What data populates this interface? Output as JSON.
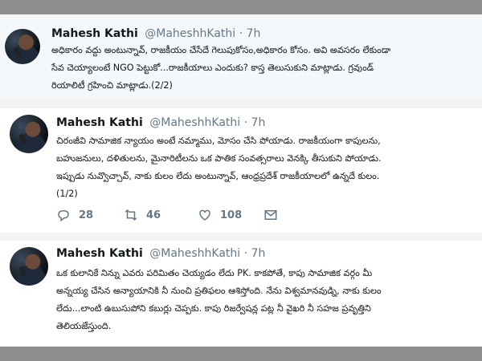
{
  "tweets": [
    {
      "name": "Mahesh Kathi",
      "handle": "@MaheshhKathi",
      "time": "· 7h",
      "text": "అధికారం వద్దు అంటున్నావ్, రాజకీయం చేసేదే గెలుపుకోసం,అధికారం కోసం. అవి అవసరం లేకుండా\nసేవ చెయ్యాలంటే NGO పెట్టుకో...రాజకీయాలు ఎందుకు? కాస్త తెలుసుకుని మాట్లాడు. గ్రవుండ్\nరియాలిటీ గ్రహించి మాట్లాడు.(2/2)"
    },
    {
      "name": "Mahesh Kathi",
      "handle": "@MaheshhKathi",
      "time": "· 7h",
      "text": "చిరంజీవి సామాజిక న్యాయం అంటే నమ్మాము, మోసం చేసి పోయాడు. రాజకీయంగా కాపులను,\nబహుజనులు, దళితులను, మైనారిటీలను ఒక పాతిక సంవత్సరాలు వెనక్కి తీసుకుని పోయాడు.\nఇప్పుడు నువ్వొచ్చావ్, నాకు కులం లేదు అంటున్నావ్, ఆంధ్రప్రదేశ్ రాజకీయాలలో ఉన్నదే కులం.\n(1/2)",
      "replies": "28",
      "retweets": "46",
      "likes": "108"
    },
    {
      "name": "Mahesh Kathi",
      "handle": "@MaheshhKathi",
      "time": "· 7h",
      "text": "ఒక కులానికే నిన్ను ఎవరు పరిమితం చెయ్యడం లేదు PK. కాకపోతే, కాపు సామాజిక వర్గం మీ\nఅన్నయ్య చేసిన అన్యాయానికి నీ నుంచి ప్రతిఫలం ఆశిస్తోంది. నేను విశ్వమానవుడ్ని, నాకు కులం\nలేదు...లాంటి ఉబుసుపోని కబుర్లు చెప్పకు. కాపు రిజర్వేషన్ల పట్ల నీ వైఖరి నీ సహజ ప్రవృత్తిని\nతెలియజేస్తుంది."
    }
  ],
  "icons": {
    "reply": "reply-icon",
    "retweet": "retweet-icon",
    "like": "heart-icon",
    "message": "envelope-icon"
  }
}
